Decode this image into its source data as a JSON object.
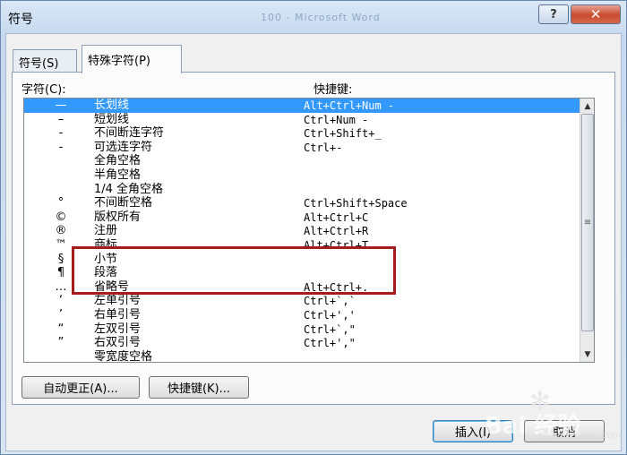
{
  "window": {
    "title": "符号",
    "background_title": "100 - Microsoft Word",
    "help_label": "?",
    "close_label": "✕"
  },
  "tabs": [
    {
      "label": "符号(S)"
    },
    {
      "label": "特殊字符(P)"
    }
  ],
  "columns": {
    "character": "字符(C):",
    "shortcut": "快捷键:"
  },
  "rows": [
    {
      "symbol": "—",
      "name": "长划线",
      "shortcut": "Alt+Ctrl+Num -",
      "selected": true
    },
    {
      "symbol": "–",
      "name": "短划线",
      "shortcut": "Ctrl+Num -"
    },
    {
      "symbol": "-",
      "name": "不间断连字符",
      "shortcut": "Ctrl+Shift+_"
    },
    {
      "symbol": "-",
      "name": "可选连字符",
      "shortcut": "Ctrl+-"
    },
    {
      "symbol": "",
      "name": "全角空格",
      "shortcut": ""
    },
    {
      "symbol": "",
      "name": "半角空格",
      "shortcut": ""
    },
    {
      "symbol": "",
      "name": "1/4 全角空格",
      "shortcut": ""
    },
    {
      "symbol": "°",
      "name": "不间断空格",
      "shortcut": "Ctrl+Shift+Space"
    },
    {
      "symbol": "©",
      "name": "版权所有",
      "shortcut": "Alt+Ctrl+C"
    },
    {
      "symbol": "®",
      "name": "注册",
      "shortcut": "Alt+Ctrl+R"
    },
    {
      "symbol": "™",
      "name": "商标",
      "shortcut": "Alt+Ctrl+T"
    },
    {
      "symbol": "§",
      "name": "小节",
      "shortcut": ""
    },
    {
      "symbol": "¶",
      "name": "段落",
      "shortcut": ""
    },
    {
      "symbol": "…",
      "name": "省略号",
      "shortcut": "Alt+Ctrl+."
    },
    {
      "symbol": "‘",
      "name": "左单引号",
      "shortcut": "Ctrl+`,`"
    },
    {
      "symbol": "’",
      "name": "右单引号",
      "shortcut": "Ctrl+','"
    },
    {
      "symbol": "“",
      "name": "左双引号",
      "shortcut": "Ctrl+`,\""
    },
    {
      "symbol": "”",
      "name": "右双引号",
      "shortcut": "Ctrl+',\""
    },
    {
      "symbol": "",
      "name": "零宽度空格",
      "shortcut": ""
    }
  ],
  "buttons": {
    "autocorrect": "自动更正(A)...",
    "shortcut_key": "快捷键(K)...",
    "insert": "插入(I)",
    "cancel": "取消"
  },
  "watermark": {
    "text": "Bai 经验",
    "sub": "jingyan.baidu.com"
  },
  "colors": {
    "selection": "#3399ff",
    "highlight_box": "#a51c1c"
  }
}
